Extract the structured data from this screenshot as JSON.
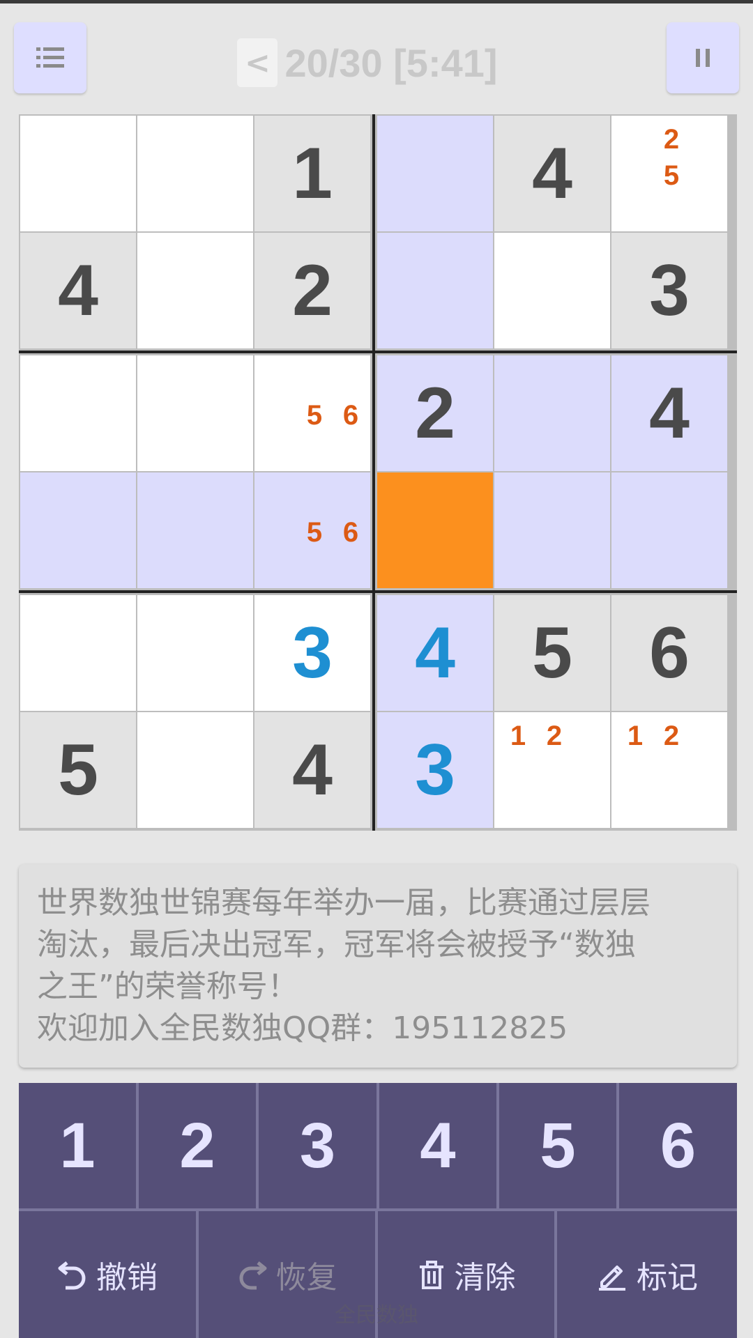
{
  "header": {
    "back_label": "<",
    "progress": "20/30",
    "timer": "[5:41]",
    "menu_icon": "list-icon",
    "pause_icon": "pause-icon"
  },
  "board": {
    "size": 6,
    "box_rows": 2,
    "box_cols": 3,
    "colors": {
      "white": "#ffffff",
      "given": "#e3e3e3",
      "highlight": "#dcdcfc",
      "selected": "#fc901e",
      "given_text": "#4a4a4a",
      "user_text": "#1e8fd2",
      "note_text": "#dc5a14"
    },
    "cells": [
      [
        {
          "bg": "white"
        },
        {
          "bg": "white"
        },
        {
          "bg": "given",
          "v": "1"
        },
        {
          "bg": "highlight"
        },
        {
          "bg": "given",
          "v": "4"
        },
        {
          "bg": "white",
          "notes": [
            "2",
            "5"
          ]
        }
      ],
      [
        {
          "bg": "given",
          "v": "4"
        },
        {
          "bg": "white"
        },
        {
          "bg": "given",
          "v": "2"
        },
        {
          "bg": "highlight"
        },
        {
          "bg": "white"
        },
        {
          "bg": "given",
          "v": "3"
        }
      ],
      [
        {
          "bg": "white"
        },
        {
          "bg": "white"
        },
        {
          "bg": "white",
          "notes": [
            "5",
            "6"
          ]
        },
        {
          "bg": "highlight",
          "v": "2"
        },
        {
          "bg": "highlight"
        },
        {
          "bg": "highlight",
          "v": "4"
        }
      ],
      [
        {
          "bg": "highlight"
        },
        {
          "bg": "highlight"
        },
        {
          "bg": "highlight",
          "notes": [
            "5",
            "6"
          ]
        },
        {
          "bg": "selected"
        },
        {
          "bg": "highlight"
        },
        {
          "bg": "highlight"
        }
      ],
      [
        {
          "bg": "white"
        },
        {
          "bg": "white"
        },
        {
          "bg": "white",
          "v": "3",
          "user": true
        },
        {
          "bg": "highlight",
          "v": "4",
          "user": true
        },
        {
          "bg": "given",
          "v": "5"
        },
        {
          "bg": "given",
          "v": "6"
        }
      ],
      [
        {
          "bg": "given",
          "v": "5"
        },
        {
          "bg": "white"
        },
        {
          "bg": "given",
          "v": "4"
        },
        {
          "bg": "highlight",
          "v": "3",
          "user": true
        },
        {
          "bg": "white",
          "notes": [
            "1",
            "2"
          ]
        },
        {
          "bg": "white",
          "notes": [
            "1",
            "2"
          ]
        }
      ]
    ]
  },
  "tip": {
    "line1": "世界数独世锦赛每年举办一届，比赛通过层层",
    "line2": "淘汰，最后决出冠军，冠军将会被授予“数独",
    "line3": "之王”的荣誉称号！",
    "line4": "欢迎加入全民数独QQ群：195112825"
  },
  "keypad": {
    "digits": [
      "1",
      "2",
      "3",
      "4",
      "5",
      "6"
    ],
    "undo_label": "撤销",
    "redo_label": "恢复",
    "clear_label": "清除",
    "mark_label": "标记",
    "undo_icon": "undo-icon",
    "redo_icon": "redo-icon",
    "clear_icon": "trash-icon",
    "mark_icon": "pencil-icon"
  },
  "footer": {
    "text": "全民数独"
  }
}
